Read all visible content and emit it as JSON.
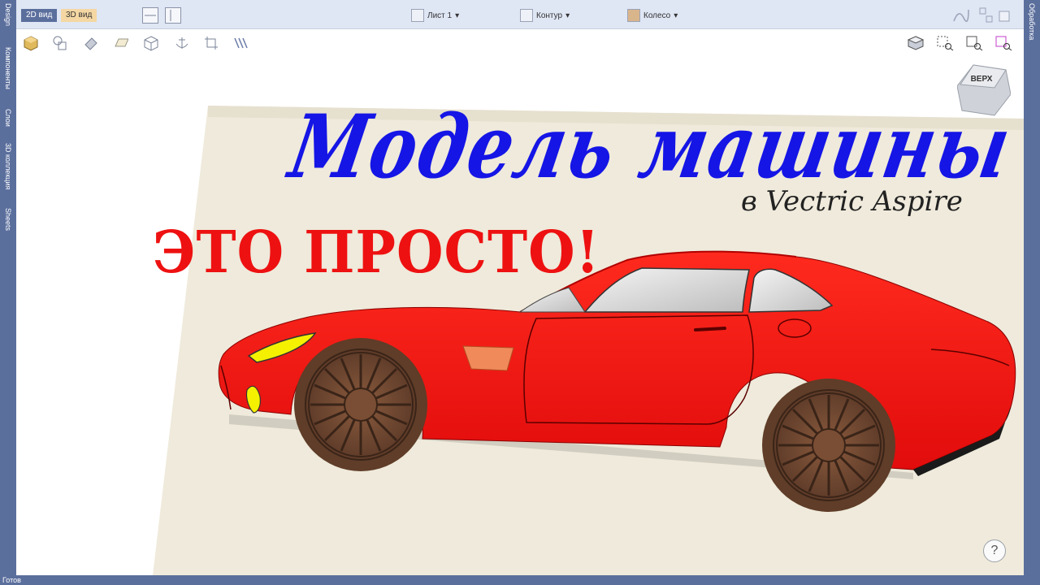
{
  "left_tabs": [
    "Design",
    "Компоненты",
    "Слои",
    "3D коллекция",
    "Sheets"
  ],
  "right_tabs": [
    "Обработка"
  ],
  "top_bar": {
    "tab_2d": "2D вид",
    "tab_3d": "3D вид",
    "sheet_label": "Лист 1",
    "contour_label": "Контур",
    "wheel_label": "Колесо"
  },
  "toolbar_icons": [
    "model-cube-icon",
    "shapes-icon",
    "eraser-icon",
    "sheet-plane-icon",
    "wireframe-cube-icon",
    "anchor-icon",
    "crop-icon",
    "toolpath-icon"
  ],
  "view_tools": [
    "view-orientation-icon",
    "zoom-box-icon",
    "zoom-fit-icon",
    "zoom-selection-icon"
  ],
  "view_cube_label": "ВЕРХ",
  "canvas": {
    "title": "Модель машины",
    "subtitle": "в Vectric Aspire",
    "slogan": "ЭТО ПРОСТО!"
  },
  "help_label": "?",
  "status_text": "Готов",
  "colors": {
    "frame": "#5b6f9d",
    "title": "#1515e6",
    "slogan": "#ee1111",
    "car_body": "#ee1111",
    "board": "#efeadb"
  }
}
